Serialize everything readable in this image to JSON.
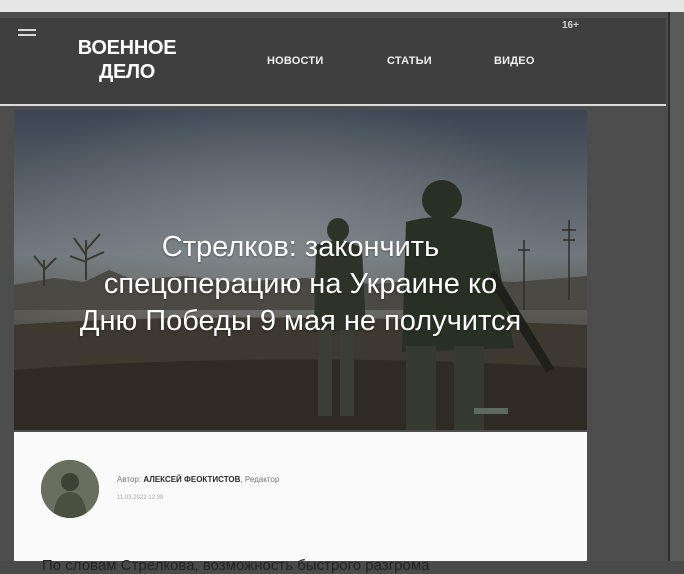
{
  "header": {
    "logo_line1": "ВОЕННОЕ",
    "logo_line2": "ДЕЛО",
    "nav": [
      "НОВОСТИ",
      "СТАТЬИ",
      "ВИДЕО"
    ],
    "corner_text": "16+"
  },
  "hero": {
    "title_lines": [
      "Стрелков: закончить",
      "спецоперацию на Украине ко",
      "Дню Победы 9 мая не получится"
    ]
  },
  "article": {
    "byline_prefix": "Автор:",
    "author": "АЛЕКСЕЙ ФЕОКТИСТОВ",
    "role": ", Редактор",
    "date": "11.03.2022 12:09",
    "lead": "По словам Стрелкова, возможность быстрого разгрома"
  },
  "colors": {
    "header_bg": "#3f3f3f",
    "page_bg": "#4d4d4d",
    "card_bg": "#fafafa"
  }
}
